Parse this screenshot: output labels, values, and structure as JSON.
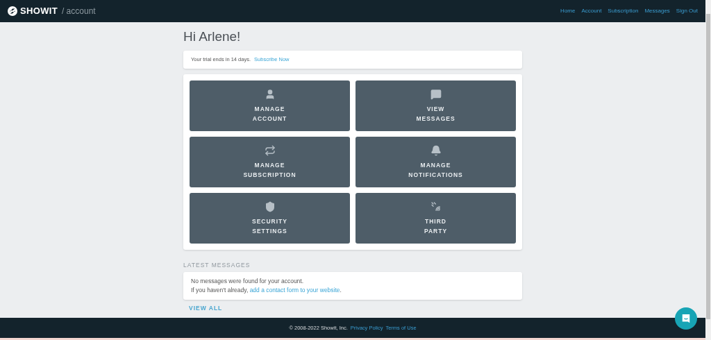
{
  "header": {
    "logo": "SHOWIT",
    "section": "/ account",
    "nav": [
      {
        "label": "Home"
      },
      {
        "label": "Account"
      },
      {
        "label": "Subscription"
      },
      {
        "label": "Messages"
      },
      {
        "label": "Sign Out"
      }
    ]
  },
  "greeting": "Hi Arlene!",
  "trial": {
    "text": "Your trial ends in 14 days.",
    "link": "Subscribe Now"
  },
  "tiles": [
    {
      "lines": [
        "MANAGE",
        "ACCOUNT"
      ]
    },
    {
      "lines": [
        "VIEW",
        "MESSAGES"
      ]
    },
    {
      "lines": [
        "MANAGE",
        "SUBSCRIPTION"
      ]
    },
    {
      "lines": [
        "MANAGE",
        "NOTIFICATIONS"
      ]
    },
    {
      "lines": [
        "SECURITY",
        "SETTINGS"
      ]
    },
    {
      "lines": [
        "THIRD",
        "PARTY"
      ]
    }
  ],
  "messages": {
    "heading": "LATEST MESSAGES",
    "line1": "No messages were found for your account.",
    "line2_prefix": "If you haven't already,",
    "line2_link": "add a contact form to your website",
    "line2_suffix": ".",
    "view_all": "VIEW ALL"
  },
  "footer": {
    "copyright": "© 2008-2022 Showit, Inc.",
    "links": [
      "Privacy Policy",
      "Terms of Use"
    ]
  }
}
